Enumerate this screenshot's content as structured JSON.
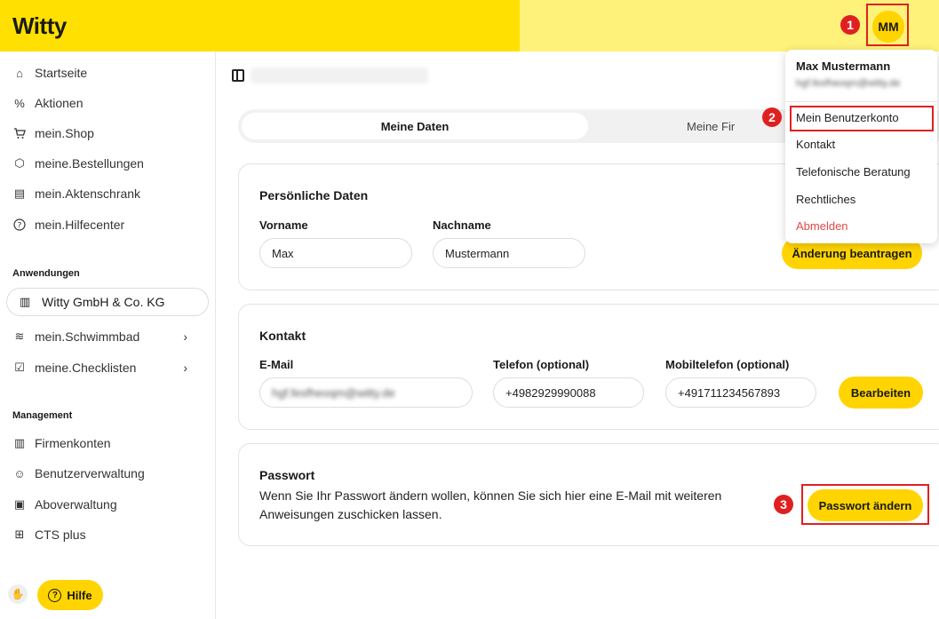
{
  "header": {
    "logo": "Witty",
    "avatar_initials": "MM"
  },
  "annotations": [
    "1",
    "2",
    "3"
  ],
  "sidebar": {
    "nav": [
      {
        "label": "Startseite",
        "icon": "home-icon",
        "glyph": "⌂"
      },
      {
        "label": "Aktionen",
        "icon": "percent-icon",
        "glyph": "%"
      },
      {
        "label": "mein.Shop",
        "icon": "cart-icon",
        "glyph": "🛒"
      },
      {
        "label": "meine.Bestellungen",
        "icon": "package-icon",
        "glyph": "⬡"
      },
      {
        "label": "mein.Aktenschrank",
        "icon": "cabinet-icon",
        "glyph": "▤"
      },
      {
        "label": "mein.Hilfecenter",
        "icon": "help-circle-icon",
        "glyph": "?"
      }
    ],
    "apps_label": "Anwendungen",
    "company": "Witty GmbH & Co. KG",
    "apps": [
      {
        "label": "mein.Schwimmbad",
        "icon": "pool-icon",
        "glyph": "≋"
      },
      {
        "label": "meine.Checklisten",
        "icon": "checklist-icon",
        "glyph": "☑"
      }
    ],
    "management_label": "Management",
    "management": [
      {
        "label": "Firmenkonten",
        "icon": "building-icon",
        "glyph": "▥"
      },
      {
        "label": "Benutzerverwaltung",
        "icon": "users-icon",
        "glyph": "☺"
      },
      {
        "label": "Aboverwaltung",
        "icon": "subscription-icon",
        "glyph": "▣"
      },
      {
        "label": "CTS plus",
        "icon": "grid-plus-icon",
        "glyph": "⊞"
      }
    ],
    "help_label": "Hilfe"
  },
  "tabs": {
    "active": "Meine Daten",
    "inactive": "Meine Fir"
  },
  "personal": {
    "title": "Persönliche Daten",
    "first_label": "Vorname",
    "first_value": "Max",
    "last_label": "Nachname",
    "last_value": "Mustermann",
    "request_change": "Änderung beantragen"
  },
  "contact": {
    "title": "Kontakt",
    "email_label": "E-Mail",
    "email_value": "hgf.fesfheoqm@witty.de",
    "phone_label": "Telefon (optional)",
    "phone_value": "+4982929990088",
    "mobile_label": "Mobiltelefon (optional)",
    "mobile_value": "+491711234567893",
    "edit": "Bearbeiten"
  },
  "password": {
    "title": "Passwort",
    "description": "Wenn Sie Ihr Passwort ändern wollen, können Sie sich hier eine E-Mail mit weiteren Anweisungen zuschicken lassen.",
    "change": "Passwort ändern"
  },
  "user_menu": {
    "name": "Max Mustermann",
    "email": "hgf.fesfheoqm@witty.de",
    "items": [
      "Mein Benutzerkonto",
      "Kontakt",
      "Telefonische Beratung",
      "Rechtliches"
    ],
    "logout": "Abmelden"
  }
}
